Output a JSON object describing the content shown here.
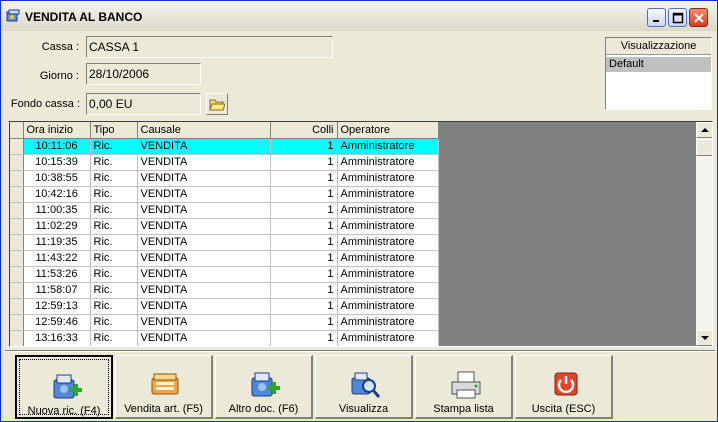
{
  "window": {
    "title": "VENDITA AL BANCO"
  },
  "form": {
    "cassa_label": "Cassa :",
    "cassa_value": "CASSA 1",
    "giorno_label": "Giorno :",
    "giorno_value": "28/10/2006",
    "fondo_label": "Fondo cassa :",
    "fondo_value": "0,00 EU"
  },
  "visualizzazione": {
    "header": "Visualizzazione",
    "selected": "Default"
  },
  "grid": {
    "columns": [
      "Ora inizio",
      "Tipo",
      "Causale",
      "Colli",
      "Operatore"
    ],
    "rows": [
      [
        "10:11:06",
        "Ric.",
        "VENDITA",
        "1",
        "Amministratore"
      ],
      [
        "10:15:39",
        "Ric.",
        "VENDITA",
        "1",
        "Amministratore"
      ],
      [
        "10:38:55",
        "Ric.",
        "VENDITA",
        "1",
        "Amministratore"
      ],
      [
        "10:42:16",
        "Ric.",
        "VENDITA",
        "1",
        "Amministratore"
      ],
      [
        "11:00:35",
        "Ric.",
        "VENDITA",
        "1",
        "Amministratore"
      ],
      [
        "11:02:29",
        "Ric.",
        "VENDITA",
        "1",
        "Amministratore"
      ],
      [
        "11:19:35",
        "Ric.",
        "VENDITA",
        "1",
        "Amministratore"
      ],
      [
        "11:43:22",
        "Ric.",
        "VENDITA",
        "1",
        "Amministratore"
      ],
      [
        "11:53:26",
        "Ric.",
        "VENDITA",
        "1",
        "Amministratore"
      ],
      [
        "11:58:07",
        "Ric.",
        "VENDITA",
        "1",
        "Amministratore"
      ],
      [
        "12:59:13",
        "Ric.",
        "VENDITA",
        "1",
        "Amministratore"
      ],
      [
        "12:59:46",
        "Ric.",
        "VENDITA",
        "1",
        "Amministratore"
      ],
      [
        "13:16:33",
        "Ric.",
        "VENDITA",
        "1",
        "Amministratore"
      ]
    ],
    "selected_row": 0
  },
  "toolbar": {
    "nuova_ric": "Nuova ric. (F4)",
    "vendita_art": "Vendita art. (F5)",
    "altro_doc": "Altro doc. (F6)",
    "visualizza": "Visualizza",
    "stampa_lista": "Stampa lista",
    "uscita": "Uscita (ESC)"
  },
  "colors": {
    "selection": "#00ffff",
    "panel": "#ece9d8",
    "grid_empty": "#808080"
  }
}
